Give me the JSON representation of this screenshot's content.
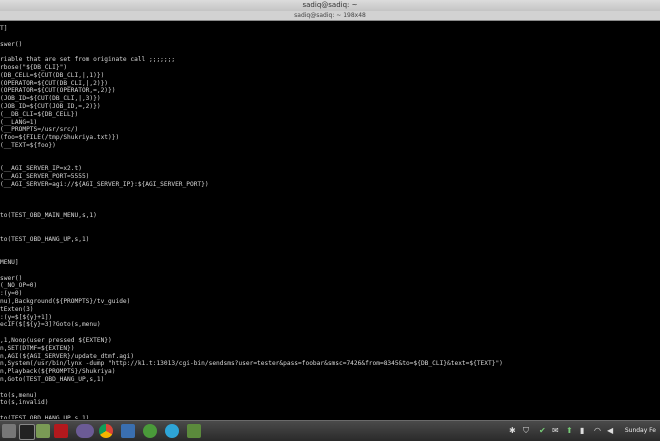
{
  "window": {
    "title": "sadiq@sadiq: ~",
    "tab_title": "sadiq@sadiq: ~ 198x48"
  },
  "terminal": {
    "lines": [
      "T]",
      "",
      "swer()",
      "",
      "riable that are set from originate call ;;;;;;;",
      "rbose(\"${DB_CLI}\")",
      "(DB_CELL=${CUT(DB_CLI,|,1)})",
      "(OPERATOR=${CUT(DB_CLI,|,2)})",
      "(OPERATOR=${CUT(OPERATOR,=,2)})",
      "(JOB_ID=${CUT(DB_CLI,|,3)})",
      "(JOB_ID=${CUT(JOB_ID,=,2)})",
      "(__DB_CLI=${DB_CELL})",
      "(__LANG=1)",
      "(__PROMPTS=/usr/src/)",
      "(foo=${FILE(/tmp/Shukriya.txt)})",
      "(__TEXT=${foo})",
      "",
      "",
      "(__AGI_SERVER_IP=x2.t)",
      "(__AGI_SERVER_PORT=5555)",
      "(__AGI_SERVER=agi://${AGI_SERVER_IP}:${AGI_SERVER_PORT})",
      "",
      "",
      "",
      "to(TEST_OBD_MAIN_MENU,s,1)",
      "",
      "",
      "to(TEST_OBD_HANG_UP,s,1)",
      "",
      "",
      "MENU]",
      "",
      "swer()",
      "(_NO_OP=0)",
      ":(y=0)",
      "nu),Background(${PROMPTS}/tv_guide)",
      "tExten(3)",
      ":(y=$[${y}+1])",
      "ecIF($[${y}=3]?Goto(s,menu)",
      "",
      ",1,Noop(user pressed ${EXTEN})",
      "n,SET(DTMF=${EXTEN})",
      "n,AGI(${AGI_SERVER}/update_dtmf.agi)",
      "n,System(/usr/bin/lynx -dump \"http://k1.t:13013/cgi-bin/sendsms?user=tester&pass=foobar&smsc=7426&from=8345&to=${DB_CLI}&text=${TEXT}\")",
      "n,Playback(${PROMPTS}/Shukriya)",
      "n,Goto(TEST_OBD_HANG_UP,s,1)",
      "",
      "to(s,menu)",
      "to(s,invalid)",
      "",
      "to(TEST_OBD_HANG_UP,s,1)"
    ]
  },
  "taskbar": {
    "apps": [
      "files-icon",
      "terminal-icon",
      "folder-icon",
      "text-editor-icon",
      "media-icon",
      "chrome-icon",
      "flowchart-icon",
      "code-editor-icon",
      "android-icon",
      "skype-icon",
      "spreadsheet-icon"
    ],
    "clock": "Sunday Fe"
  },
  "colors": {
    "terminal_bg": "#000000",
    "terminal_fg": "#d8d8d8",
    "taskbar_bg": "#3a3a3a"
  }
}
